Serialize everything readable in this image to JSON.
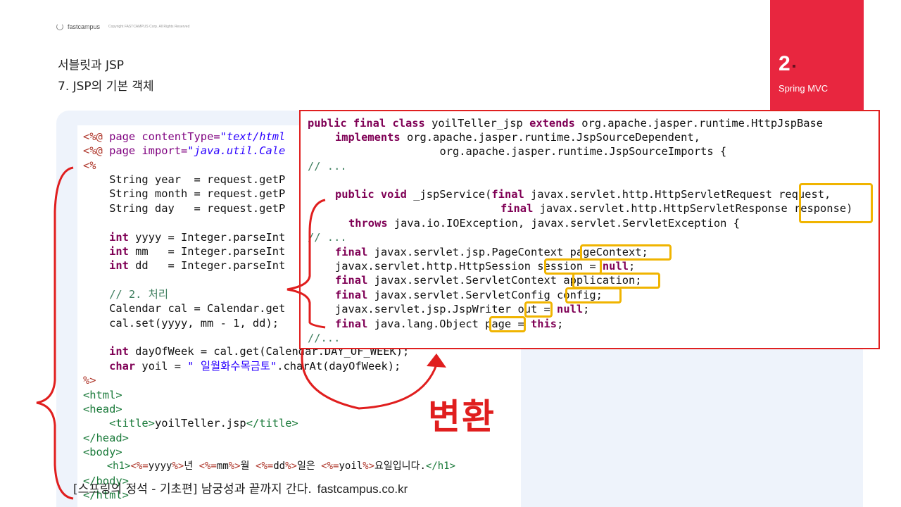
{
  "header": {
    "logo": "fastcampus",
    "copyright": "Copyright FASTCAMPUS Corp. All Rights Reserved",
    "title_line1": "서블릿과 JSP",
    "title_line2": "7. JSP의 기본 객체"
  },
  "section_tab": {
    "number": "2",
    "name": "Spring MVC",
    "color": "#e8263f"
  },
  "left_code": {
    "line1_tag": "<%@",
    "line1_rest": " page contentType=",
    "line1_str": "\"text/html",
    "line2_tag": "<%@",
    "line2_rest": " page import=",
    "line2_str": "\"java.util.Cale",
    "line3": "<%",
    "line4": "    String year  = request.getP",
    "line5": "    String month = request.getP",
    "line6": "    String day   = request.getP",
    "line8_kw": "int",
    "line8": " yyyy = Integer.parseInt",
    "line9_kw": "int",
    "line9": " mm   = Integer.parseInt",
    "line10_kw": "int",
    "line10": " dd   = Integer.parseInt",
    "line12": "    // 2. 처리",
    "line13": "    Calendar cal = Calendar.get",
    "line14": "    cal.set(yyyy, mm - 1, dd);",
    "line16_kw": "int",
    "line16": " dayOfWeek = cal.get(Calendar.DAY_OF_WEEK);",
    "line17_kw": "char",
    "line17_a": " yoil = ",
    "line17_str": "\" 일월화수목금토\"",
    "line17_b": ".charAt(dayOfWeek);",
    "line18": "%>",
    "line19": "<html>",
    "line20": "<head>",
    "line21_open": "<title>",
    "line21_text": "yoilTeller.jsp",
    "line21_close": "</title>",
    "line22": "</head>",
    "line23": "<body>",
    "line24_h1": "<h1>",
    "line24_t1": "<%=",
    "line24_v1": "yyyy",
    "line24_c1": "%>",
    "line24_w1": "년 ",
    "line24_t2": "<%=",
    "line24_v2": "mm",
    "line24_c2": "%>",
    "line24_w2": "월 ",
    "line24_t3": "<%=",
    "line24_v3": "dd",
    "line24_c3": "%>",
    "line24_w3": "일은 ",
    "line24_t4": "<%=",
    "line24_v4": "yoil",
    "line24_c4": "%>",
    "line24_w4": "요일입니다.",
    "line24_h1c": "</h1>",
    "line25": "</body>",
    "line26": "</html>"
  },
  "right_code": {
    "l1_kw": "public final class",
    "l1": " yoilTeller_jsp ",
    "l1_kw2": "extends",
    "l1_b": " org.apache.jasper.runtime.HttpJspBase",
    "l2_kw": "implements",
    "l2": " org.apache.jasper.runtime.JspSourceDependent,",
    "l3": "             org.apache.jasper.runtime.JspSourceImports {",
    "l4": "// ...",
    "l5_kw": "public void",
    "l5": " _jspService(",
    "l5_kw2": "final",
    "l5_b": " javax.servlet.http.HttpServletRequest request,",
    "l6_kw": "final",
    "l6": " javax.servlet.http.HttpServletResponse response)",
    "l7_kw": "throws",
    "l7": " java.io.IOException, javax.servlet.ServletException {",
    "l8": "// ...",
    "l9_kw": "final",
    "l9": " javax.servlet.jsp.PageContext pageContext;",
    "l10": "javax.servlet.http.HttpSession session = ",
    "l10_kw": "null",
    "l10_b": ";",
    "l11_kw": "final",
    "l11": " javax.servlet.ServletContext application;",
    "l12_kw": "final",
    "l12": " javax.servlet.ServletConfig config;",
    "l13": "javax.servlet.jsp.JspWriter out = ",
    "l13_kw": "null",
    "l13_b": ";",
    "l14_kw": "final",
    "l14": " java.lang.Object page = ",
    "l14_kw2": "this",
    "l14_b": ";",
    "l15": "//..."
  },
  "convert_label": "변환",
  "footer": {
    "text": "[스프링의 정석 - 기초편] 남궁성과 끝까지 간다.",
    "url": "fastcampus.co.kr"
  }
}
